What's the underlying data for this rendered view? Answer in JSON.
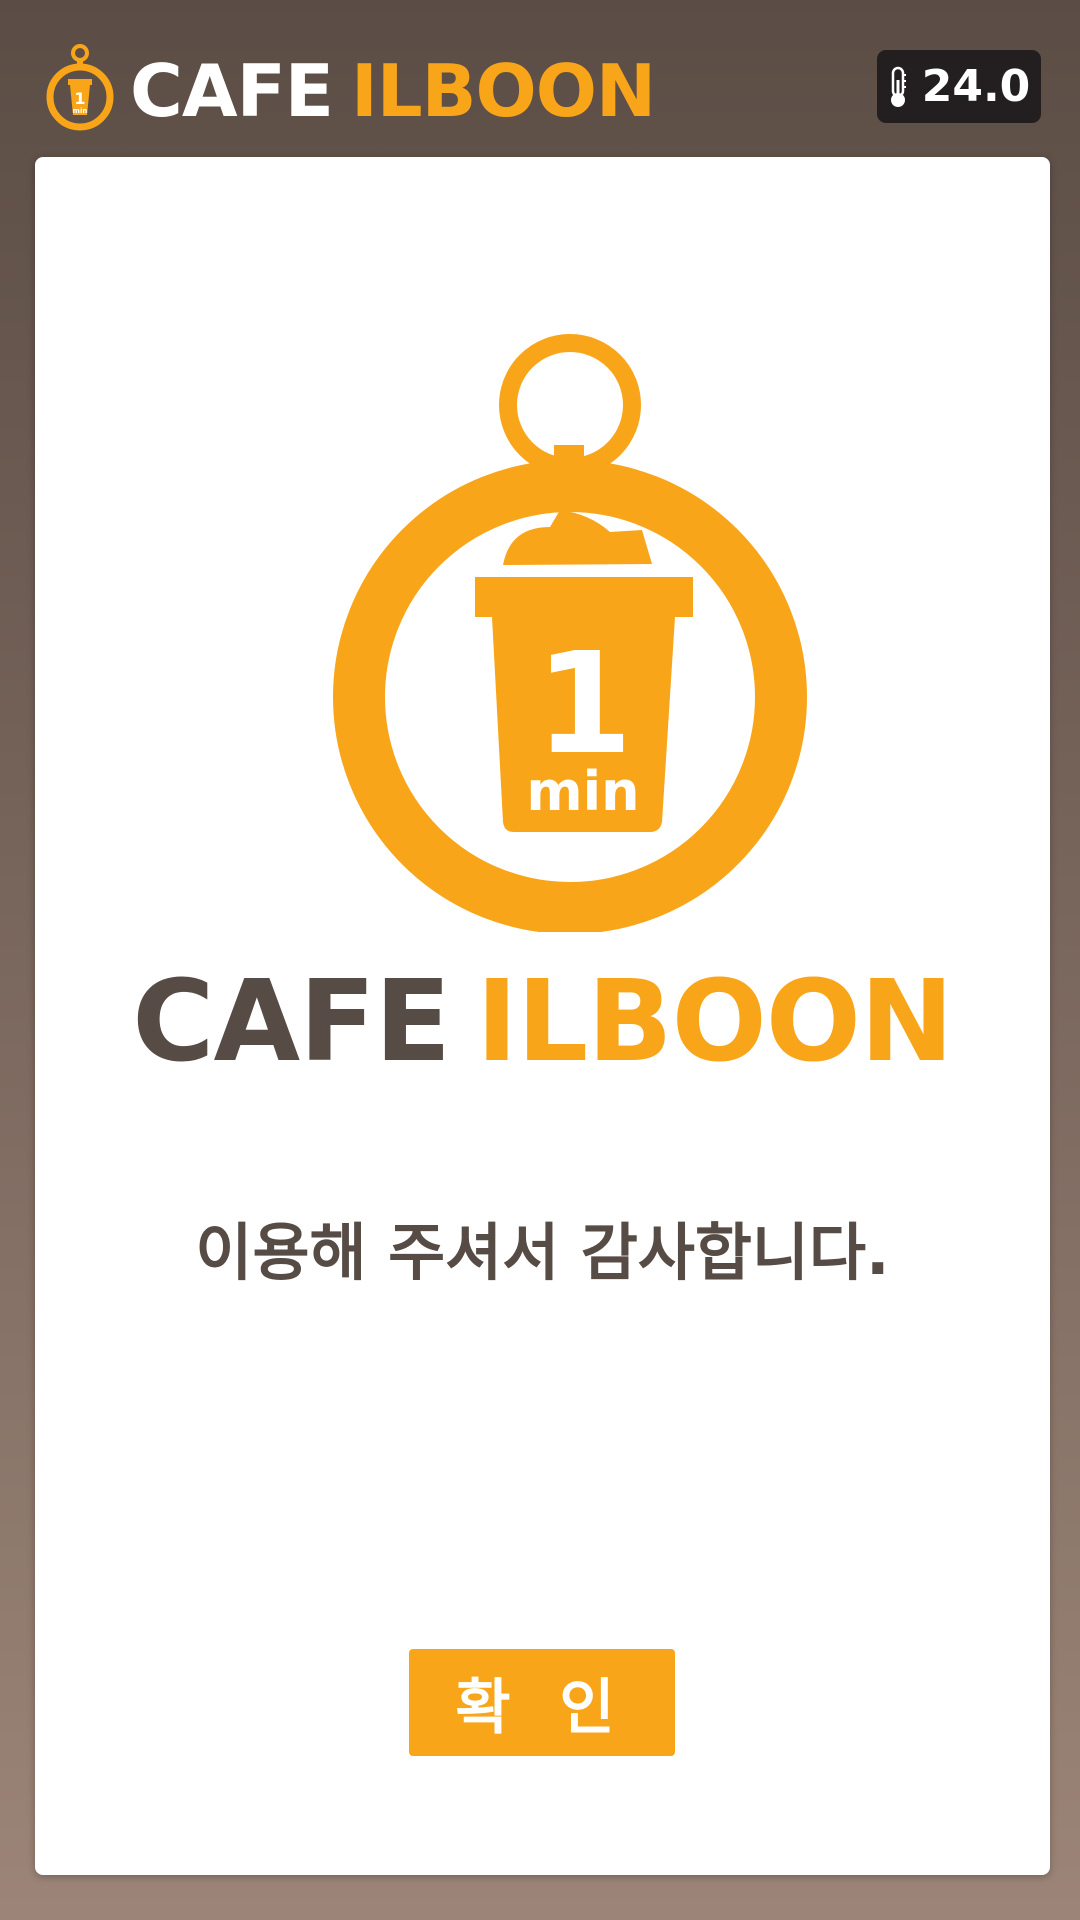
{
  "header": {
    "logo_icon": "stopwatch-cup-icon",
    "logo_cup_number": "1",
    "logo_cup_unit": "min",
    "brand_first": "CAFE",
    "brand_second": "ILBOON",
    "temperature_icon": "thermometer-icon",
    "temperature": "24.0"
  },
  "main": {
    "logo_icon": "stopwatch-cup-icon",
    "cup_number": "1",
    "cup_unit": "min",
    "brand_first": "CAFE",
    "brand_second": "ILBOON",
    "message": "이용해 주셔서 감사합니다.",
    "confirm_label": "확 인"
  },
  "colors": {
    "accent": "#f9a51a",
    "brand_dark": "#574b45",
    "badge_bg": "#231f20",
    "background_top": "#5b4d45",
    "background_bottom": "#9c8578"
  }
}
